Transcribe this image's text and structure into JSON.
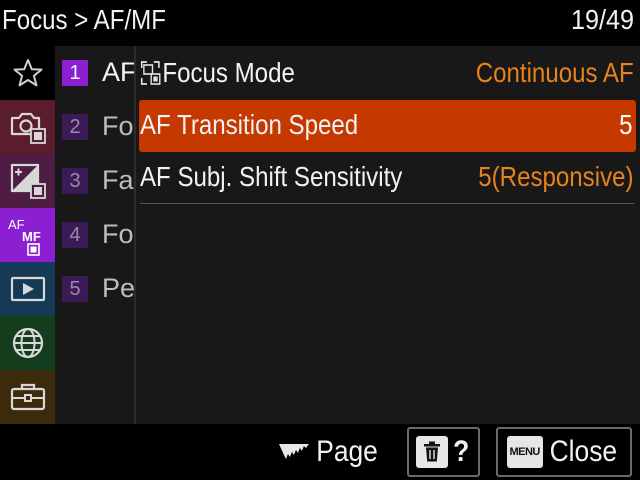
{
  "header": {
    "breadcrumb": "Focus > AF/MF",
    "page_counter": "19/49"
  },
  "categories": [
    {
      "name": "favorites",
      "icon": "star-icon",
      "color": "#000000"
    },
    {
      "name": "shooting",
      "icon": "camera-film-icon",
      "color": "#5a1d2e"
    },
    {
      "name": "exposure-color",
      "icon": "exposure-film-icon",
      "color": "#4f1c43"
    },
    {
      "name": "focus",
      "icon": "af-mf-icon",
      "label": "AF MF",
      "color": "#8d1fd2",
      "selected": true
    },
    {
      "name": "playback",
      "icon": "playback-icon",
      "color": "#153a55"
    },
    {
      "name": "network",
      "icon": "globe-icon",
      "color": "#133d1c"
    },
    {
      "name": "setup",
      "icon": "toolbox-icon",
      "color": "#3d2a0b"
    }
  ],
  "subtabs": [
    {
      "num": "1",
      "label": "AF",
      "selected": true
    },
    {
      "num": "2",
      "label": "Fo"
    },
    {
      "num": "3",
      "label": "Fa"
    },
    {
      "num": "4",
      "label": "Fo"
    },
    {
      "num": "5",
      "label": "Pe"
    }
  ],
  "menu": {
    "items": [
      {
        "label": "Focus Mode",
        "icon": "focus-mode-icon",
        "value": "Continuous AF"
      },
      {
        "label": "AF Transition Speed",
        "value": "5",
        "selected": true
      },
      {
        "label": "AF Subj. Shift Sensitivity",
        "value": "5(Responsive)"
      }
    ]
  },
  "footer": {
    "page_label": "Page",
    "help_label": "?",
    "menu_key_label": "MENU",
    "close_label": "Close"
  },
  "colors": {
    "selected_row": "#c53800",
    "value_orange": "#e8821c",
    "focus_tab_purple": "#8d1fd2"
  }
}
